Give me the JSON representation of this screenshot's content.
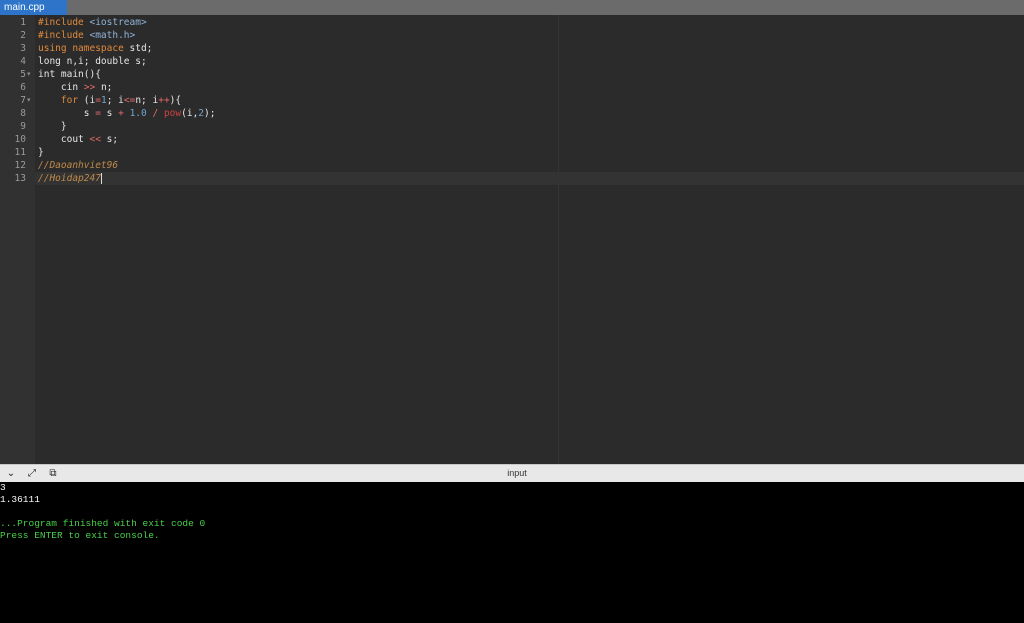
{
  "tabs": [
    {
      "label": "main.cpp",
      "active": true
    }
  ],
  "editor": {
    "lines": [
      {
        "num": "1",
        "tokens": [
          {
            "t": "#include ",
            "c": "k"
          },
          {
            "t": "<iostream>",
            "c": "s"
          }
        ]
      },
      {
        "num": "2",
        "tokens": [
          {
            "t": "#include ",
            "c": "k"
          },
          {
            "t": "<math.h>",
            "c": "s"
          }
        ]
      },
      {
        "num": "3",
        "tokens": [
          {
            "t": "using namespace ",
            "c": "k"
          },
          {
            "t": "std;",
            "c": ""
          }
        ]
      },
      {
        "num": "4",
        "tokens": [
          {
            "t": "long n,i; double s;",
            "c": ""
          }
        ]
      },
      {
        "num": "5",
        "fold": true,
        "tokens": [
          {
            "t": "int main(){",
            "c": ""
          }
        ]
      },
      {
        "num": "6",
        "tokens": [
          {
            "t": "    cin ",
            "c": ""
          },
          {
            "t": ">>",
            "c": "o"
          },
          {
            "t": " n;",
            "c": ""
          }
        ]
      },
      {
        "num": "7",
        "fold": true,
        "tokens": [
          {
            "t": "    ",
            "c": ""
          },
          {
            "t": "for",
            "c": "k"
          },
          {
            "t": " (i",
            "c": ""
          },
          {
            "t": "=",
            "c": "o"
          },
          {
            "t": "1",
            "c": "n"
          },
          {
            "t": "; i",
            "c": ""
          },
          {
            "t": "<=",
            "c": "o"
          },
          {
            "t": "n; i",
            "c": ""
          },
          {
            "t": "++",
            "c": "o"
          },
          {
            "t": "){",
            "c": ""
          }
        ]
      },
      {
        "num": "8",
        "tokens": [
          {
            "t": "        s ",
            "c": ""
          },
          {
            "t": "=",
            "c": "o"
          },
          {
            "t": " s ",
            "c": ""
          },
          {
            "t": "+",
            "c": "o"
          },
          {
            "t": " ",
            "c": ""
          },
          {
            "t": "1.0",
            "c": "n"
          },
          {
            "t": " ",
            "c": ""
          },
          {
            "t": "/",
            "c": "o"
          },
          {
            "t": " ",
            "c": ""
          },
          {
            "t": "pow",
            "c": "f"
          },
          {
            "t": "(i,",
            "c": ""
          },
          {
            "t": "2",
            "c": "n"
          },
          {
            "t": ");",
            "c": ""
          }
        ]
      },
      {
        "num": "9",
        "tokens": [
          {
            "t": "    }",
            "c": ""
          }
        ]
      },
      {
        "num": "10",
        "tokens": [
          {
            "t": "    cout ",
            "c": ""
          },
          {
            "t": "<<",
            "c": "o"
          },
          {
            "t": " s;",
            "c": ""
          }
        ]
      },
      {
        "num": "11",
        "tokens": [
          {
            "t": "}",
            "c": ""
          }
        ]
      },
      {
        "num": "12",
        "tokens": [
          {
            "t": "//Daoanhviet96",
            "c": "c"
          }
        ]
      },
      {
        "num": "13",
        "active": true,
        "cursor": true,
        "tokens": [
          {
            "t": "//Hoidap247",
            "c": "c"
          }
        ]
      }
    ]
  },
  "splitbar": {
    "label": "input",
    "icons": [
      "chevron-down-icon",
      "expand-icon",
      "copy-icon"
    ]
  },
  "console": {
    "lines": [
      {
        "text": "3",
        "color": "#ffffff"
      },
      {
        "text": "1.36111",
        "color": "#ffffff"
      },
      {
        "text": "",
        "color": "#ffffff"
      },
      {
        "text": "...Program finished with exit code 0",
        "color": "#4ad04a"
      },
      {
        "text": "Press ENTER to exit console.",
        "color": "#4ad04a"
      }
    ]
  }
}
